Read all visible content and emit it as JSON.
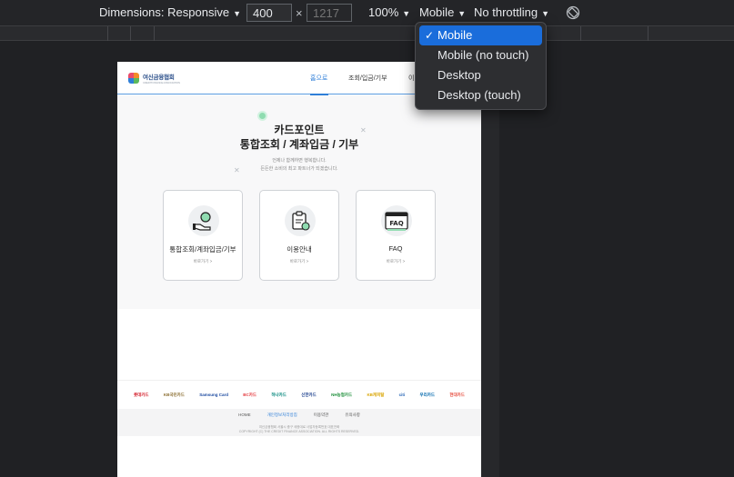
{
  "toolbar": {
    "dimensions_label": "Dimensions: Responsive",
    "width_value": "400",
    "times": "×",
    "height_placeholder": "1217",
    "zoom": "100%",
    "device_mode": "Mobile",
    "throttling": "No throttling",
    "rotate_icon": "rotate-icon"
  },
  "device_menu": {
    "items": [
      {
        "label": "Mobile",
        "selected": true
      },
      {
        "label": "Mobile (no touch)",
        "selected": false
      },
      {
        "label": "Desktop",
        "selected": false
      },
      {
        "label": "Desktop (touch)",
        "selected": false
      }
    ],
    "check": "✓",
    "accent": "#1a6ddb"
  },
  "site": {
    "logo": {
      "name": "여신금융협회",
      "sub": "CREDIT FINANCE ASSOCIATION"
    },
    "nav": [
      {
        "label": "홈으로",
        "active": true
      },
      {
        "label": "조회/입금/기부",
        "active": false
      },
      {
        "label": "이",
        "active": false
      }
    ],
    "hero": {
      "title_line1": "카드포인트",
      "title_line2": "통합조회 / 계좌입금 / 기부",
      "sub_line1": "언제나 함께하면 행복합니다.",
      "sub_line2": "든든한 소비의 최고 파트너가 되겠습니다."
    },
    "cards": [
      {
        "label": "통합조회/계좌입금/기부",
        "more": "바로가기 >",
        "icon": "coin-hand-icon"
      },
      {
        "label": "이용안내",
        "more": "바로가기 >",
        "icon": "clipboard-icon"
      },
      {
        "label": "FAQ",
        "more": "바로가기 >",
        "icon": "faq-icon"
      }
    ],
    "partners": [
      {
        "name": "롯데카드",
        "color": "#d4202c"
      },
      {
        "name": "KB국민카드",
        "color": "#8a6d2f"
      },
      {
        "name": "Samsung Card",
        "color": "#1c4aa0"
      },
      {
        "name": "BC카드",
        "color": "#e4383c"
      },
      {
        "name": "하나카드",
        "color": "#00857a"
      },
      {
        "name": "신한카드",
        "color": "#1a3e8c"
      },
      {
        "name": "NH농협카드",
        "color": "#1d8f3a"
      },
      {
        "name": "KB캐피탈",
        "color": "#d9a400"
      },
      {
        "name": "citi",
        "color": "#1e5fb3"
      },
      {
        "name": "우리카드",
        "color": "#0067ac"
      },
      {
        "name": "현대카드",
        "color": "#e64b3c"
      }
    ],
    "footer": {
      "links": [
        "HOME",
        "개인정보처리방침",
        "이용약관",
        "유의사항"
      ],
      "copy_line1": "여신금융협회 서울시 중구 세종대로 사업자등록번호 대표전화",
      "copy_line2": "COPYRIGHT (C) THE CREDIT FINANCE ASSOCIATION. ALL RIGHTS RESERVED."
    }
  },
  "colors": {
    "devtools_bg": "#202124",
    "page_bg": "#ffffff",
    "link_blue": "#2f7fd8"
  }
}
